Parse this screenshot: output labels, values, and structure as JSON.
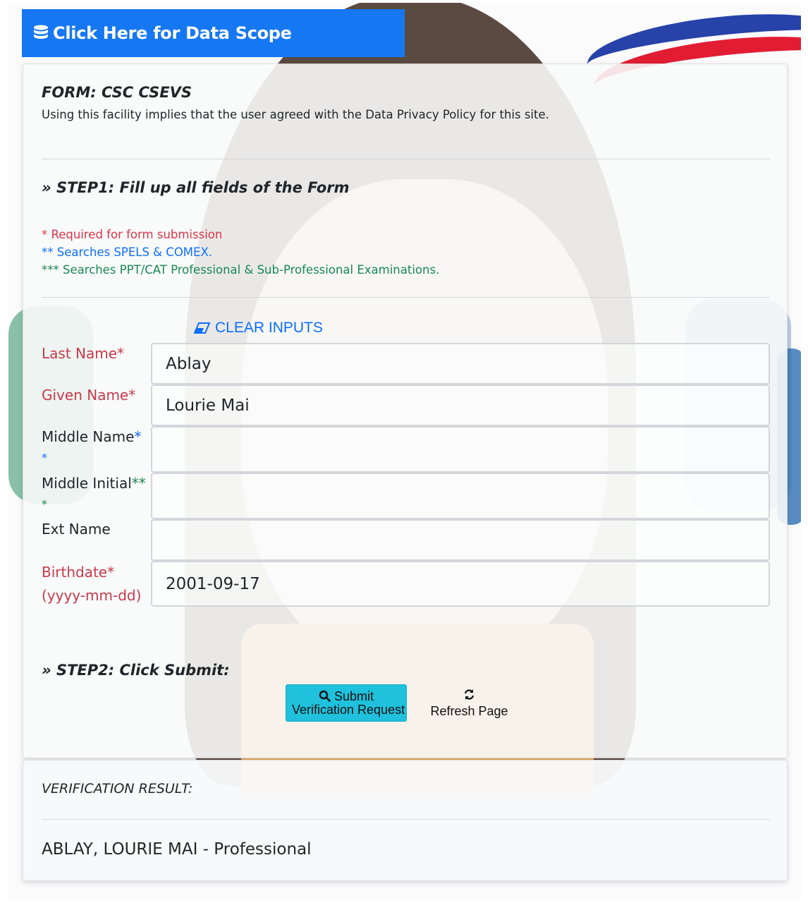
{
  "header": {
    "data_scope_label": "Click Here for Data Scope"
  },
  "form": {
    "title": "FORM: CSC CSEVS",
    "privacy_notice": "Using this facility implies that the user agreed with the Data Privacy Policy for this site.",
    "step1": "» STEP1: Fill up all fields of the Form",
    "legend": {
      "required": "* Required for form submission",
      "spels": "** Searches SPELS & COMEX.",
      "ppt": "*** Searches PPT/CAT Professional & Sub-Professional Examinations."
    },
    "clear_inputs_label": "CLEAR INPUTS",
    "fields": {
      "last_name": {
        "label": "Last Name",
        "mark": "*",
        "value": "Ablay"
      },
      "given_name": {
        "label": "Given Name",
        "mark": "*",
        "value": "Lourie Mai"
      },
      "middle_name": {
        "label": "Middle Name",
        "mark1": "*",
        "mark2": "*",
        "value": ""
      },
      "middle_initial": {
        "label": "Middle Initial",
        "mark1": "**",
        "mark2": "*",
        "value": ""
      },
      "ext_name": {
        "label": "Ext Name",
        "value": ""
      },
      "birthdate": {
        "label": "Birthdate",
        "mark": "*",
        "format": "(yyyy-mm-dd)",
        "value": "2001-09-17"
      }
    },
    "step2": "» STEP2: Click Submit:",
    "submit_label_line1": "Submit",
    "submit_label_line2": "Verification Request",
    "refresh_label": "Refresh Page"
  },
  "result": {
    "title": "VERIFICATION RESULT:",
    "text": "ABLAY, LOURIE MAI - Professional"
  },
  "colors": {
    "primary": "#1677f2",
    "required_red": "#dc3545",
    "link_blue": "#0d6efd",
    "green": "#198754",
    "submit_cyan": "#1fc1dc"
  }
}
